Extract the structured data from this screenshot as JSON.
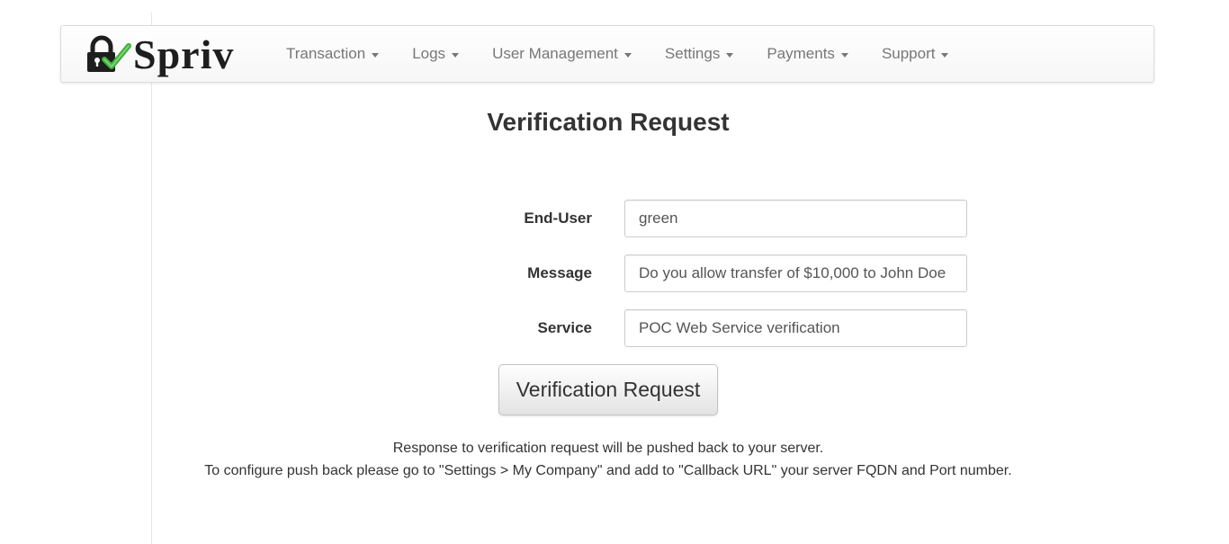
{
  "brand": {
    "name": "Spriv",
    "logo_icon": "lock-with-check-icon",
    "check_color": "#3cb03c"
  },
  "nav": {
    "items": [
      {
        "label": "Transaction"
      },
      {
        "label": "Logs"
      },
      {
        "label": "User Management"
      },
      {
        "label": "Settings"
      },
      {
        "label": "Payments"
      },
      {
        "label": "Support"
      }
    ]
  },
  "page": {
    "title": "Verification Request"
  },
  "form": {
    "end_user": {
      "label": "End-User",
      "value": "green"
    },
    "message": {
      "label": "Message",
      "value": "Do you allow transfer of $10,000 to John Doe"
    },
    "service": {
      "label": "Service",
      "value": "POC Web Service verification"
    },
    "submit_label": "Verification Request"
  },
  "notes": {
    "line1": "Response to verification request will be pushed back to your server.",
    "line2": "To configure push back please go to \"Settings > My Company\" and add to \"Callback URL\" your server FQDN and Port number."
  }
}
